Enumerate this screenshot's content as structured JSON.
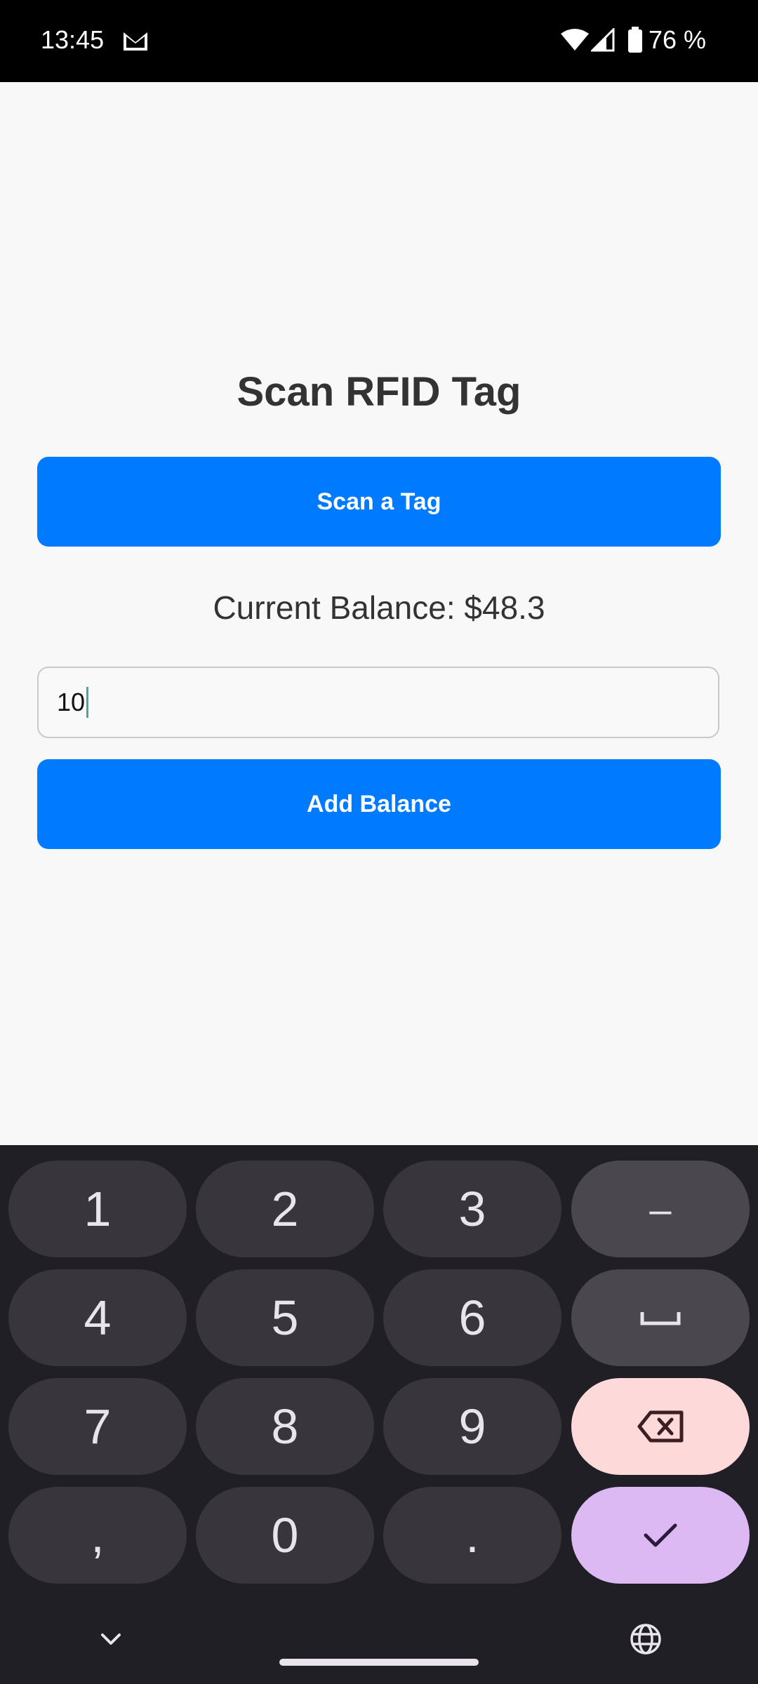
{
  "status_bar": {
    "time": "13:45",
    "battery_text": "76 %",
    "icons": [
      "mail-icon",
      "wifi-icon",
      "signal-icon",
      "battery-icon"
    ]
  },
  "app": {
    "title": "Scan RFID Tag",
    "scan_button_label": "Scan a Tag",
    "balance_text": "Current Balance: $48.3",
    "amount_input_value": "10",
    "add_button_label": "Add Balance",
    "accent_color": "#007bff"
  },
  "keyboard": {
    "row1": [
      "1",
      "2",
      "3",
      "–"
    ],
    "row2": [
      "4",
      "5",
      "6",
      "␣"
    ],
    "row3": [
      "7",
      "8",
      "9"
    ],
    "row4": [
      ",",
      "0",
      "."
    ],
    "delete_icon": "backspace-icon",
    "enter_icon": "check-icon",
    "nav_icons": [
      "chevron-down-icon",
      "globe-icon"
    ]
  }
}
